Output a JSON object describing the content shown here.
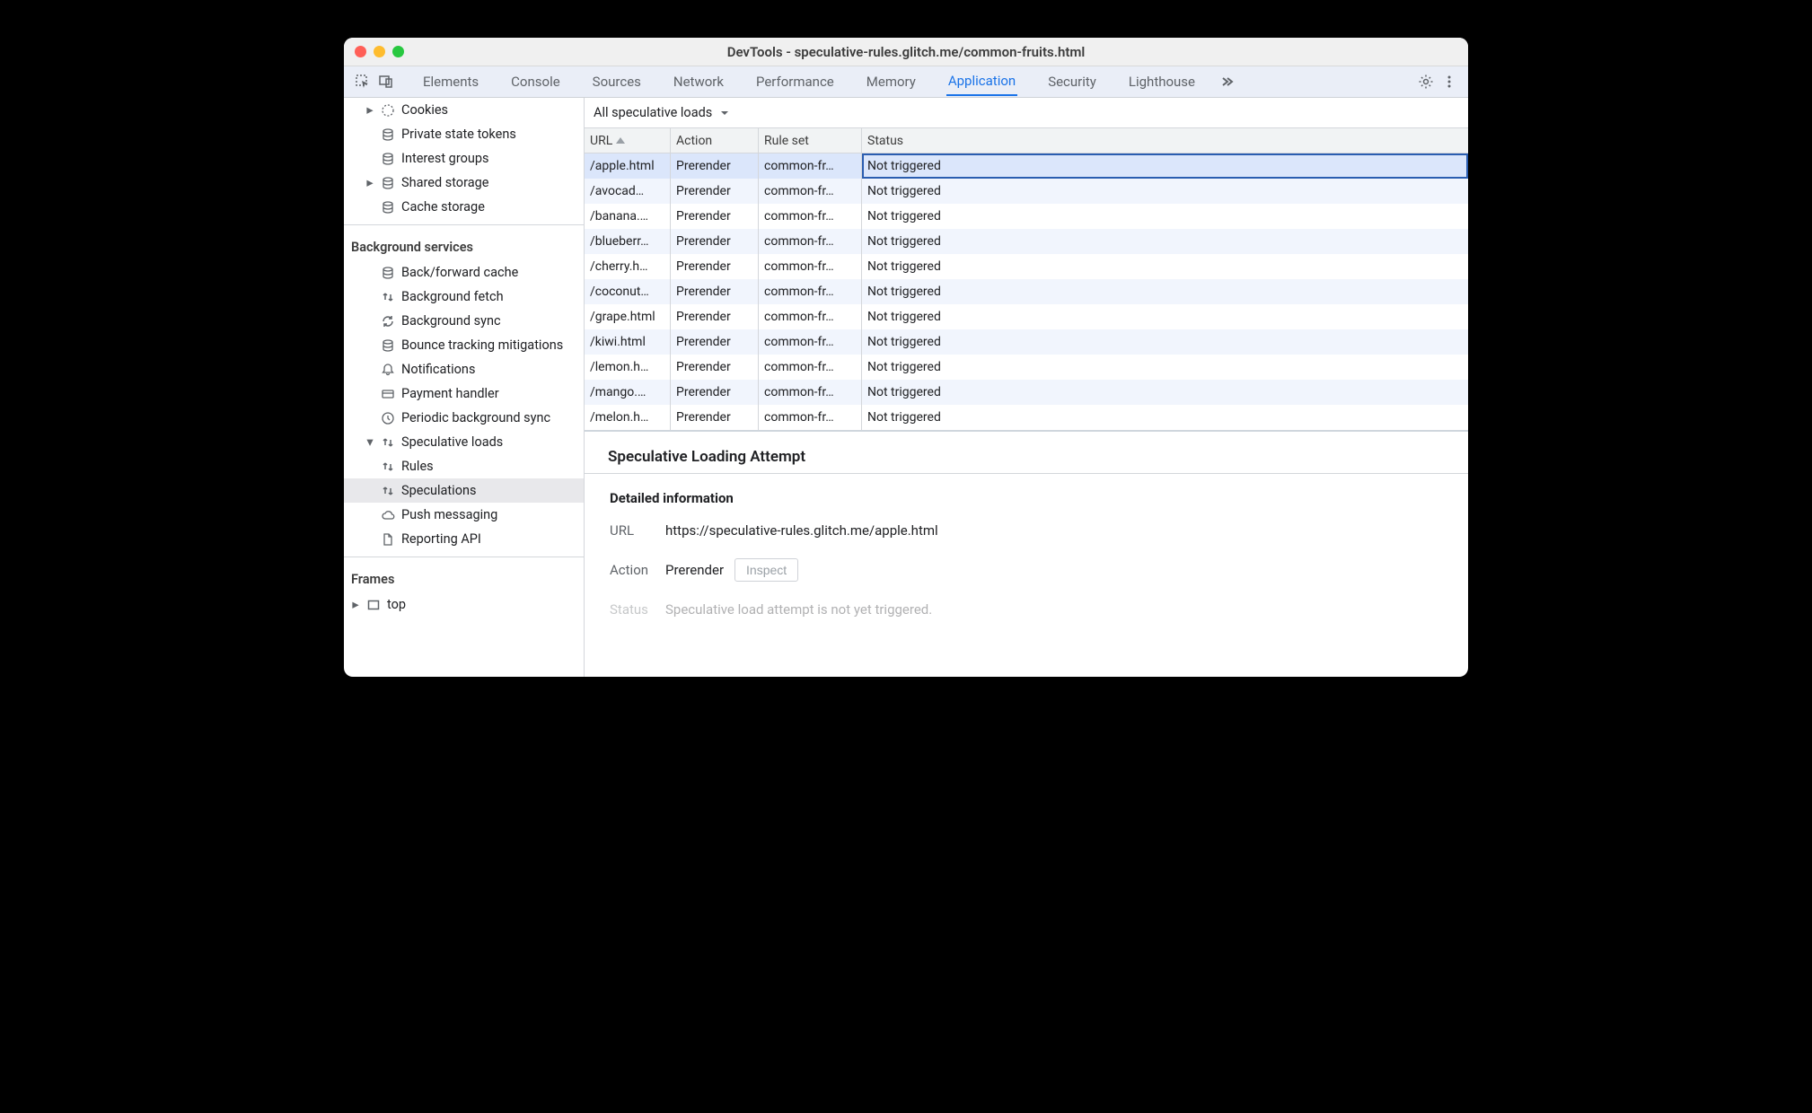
{
  "window": {
    "title": "DevTools - speculative-rules.glitch.me/common-fruits.html"
  },
  "tabs": [
    "Elements",
    "Console",
    "Sources",
    "Network",
    "Performance",
    "Memory",
    "Application",
    "Security",
    "Lighthouse"
  ],
  "active_tab": "Application",
  "sidebar": {
    "storage": [
      {
        "icon": "cookie",
        "label": "Cookies",
        "expand": true
      },
      {
        "icon": "db",
        "label": "Private state tokens"
      },
      {
        "icon": "db",
        "label": "Interest groups"
      },
      {
        "icon": "db",
        "label": "Shared storage",
        "expand": true
      },
      {
        "icon": "db",
        "label": "Cache storage"
      }
    ],
    "bg_title": "Background services",
    "background": [
      {
        "icon": "db",
        "label": "Back/forward cache"
      },
      {
        "icon": "updown",
        "label": "Background fetch"
      },
      {
        "icon": "sync",
        "label": "Background sync"
      },
      {
        "icon": "db",
        "label": "Bounce tracking mitigations"
      },
      {
        "icon": "bell",
        "label": "Notifications"
      },
      {
        "icon": "card",
        "label": "Payment handler"
      },
      {
        "icon": "clock",
        "label": "Periodic background sync"
      },
      {
        "icon": "updown",
        "label": "Speculative loads",
        "open": true,
        "children": [
          {
            "icon": "updown",
            "label": "Rules"
          },
          {
            "icon": "updown",
            "label": "Speculations",
            "selected": true
          }
        ]
      },
      {
        "icon": "cloud",
        "label": "Push messaging"
      },
      {
        "icon": "doc",
        "label": "Reporting API"
      }
    ],
    "frames_title": "Frames",
    "frames": [
      {
        "icon": "frame",
        "label": "top",
        "expand": true
      }
    ]
  },
  "filter": {
    "label": "All speculative loads"
  },
  "grid": {
    "headers": [
      "URL",
      "Action",
      "Rule set",
      "Status"
    ],
    "rows": [
      {
        "url": "/apple.html",
        "action": "Prerender",
        "ruleset": "common-fr…",
        "status": "Not triggered",
        "selected": true
      },
      {
        "url": "/avocad…",
        "action": "Prerender",
        "ruleset": "common-fr…",
        "status": "Not triggered"
      },
      {
        "url": "/banana.…",
        "action": "Prerender",
        "ruleset": "common-fr…",
        "status": "Not triggered"
      },
      {
        "url": "/blueberr…",
        "action": "Prerender",
        "ruleset": "common-fr…",
        "status": "Not triggered"
      },
      {
        "url": "/cherry.h…",
        "action": "Prerender",
        "ruleset": "common-fr…",
        "status": "Not triggered"
      },
      {
        "url": "/coconut…",
        "action": "Prerender",
        "ruleset": "common-fr…",
        "status": "Not triggered"
      },
      {
        "url": "/grape.html",
        "action": "Prerender",
        "ruleset": "common-fr…",
        "status": "Not triggered"
      },
      {
        "url": "/kiwi.html",
        "action": "Prerender",
        "ruleset": "common-fr…",
        "status": "Not triggered"
      },
      {
        "url": "/lemon.h…",
        "action": "Prerender",
        "ruleset": "common-fr…",
        "status": "Not triggered"
      },
      {
        "url": "/mango.…",
        "action": "Prerender",
        "ruleset": "common-fr…",
        "status": "Not triggered"
      },
      {
        "url": "/melon.h…",
        "action": "Prerender",
        "ruleset": "common-fr…",
        "status": "Not triggered"
      }
    ]
  },
  "detail": {
    "title": "Speculative Loading Attempt",
    "section": "Detailed information",
    "rows": {
      "url_label": "URL",
      "url": "https://speculative-rules.glitch.me/apple.html",
      "action_label": "Action",
      "action": "Prerender",
      "inspect": "Inspect",
      "status_label": "Status",
      "status": "Speculative load attempt is not yet triggered."
    }
  }
}
